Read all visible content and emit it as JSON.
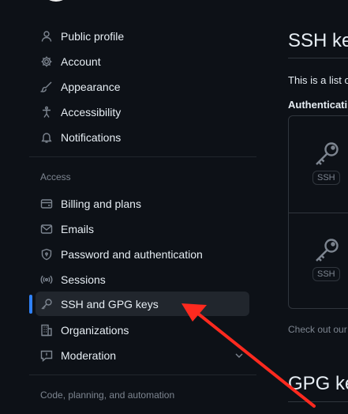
{
  "sidebar": {
    "items_top": [
      {
        "label": "Public profile",
        "icon": "person-icon"
      },
      {
        "label": "Account",
        "icon": "gear-icon"
      },
      {
        "label": "Appearance",
        "icon": "paintbrush-icon"
      },
      {
        "label": "Accessibility",
        "icon": "accessibility-icon"
      },
      {
        "label": "Notifications",
        "icon": "bell-icon"
      }
    ],
    "access_label": "Access",
    "items_access": [
      {
        "label": "Billing and plans",
        "icon": "credit-card-icon"
      },
      {
        "label": "Emails",
        "icon": "mail-icon"
      },
      {
        "label": "Password and authentication",
        "icon": "shield-lock-icon"
      },
      {
        "label": "Sessions",
        "icon": "broadcast-icon"
      },
      {
        "label": "SSH and GPG keys",
        "icon": "key-icon",
        "active": true
      },
      {
        "label": "Organizations",
        "icon": "organization-icon"
      },
      {
        "label": "Moderation",
        "icon": "report-icon"
      }
    ],
    "code_section_label": "Code, planning, and automation"
  },
  "main": {
    "ssh_title": "SSH ke",
    "intro": "This is a list o",
    "auth_heading": "Authenticati",
    "keys": [
      {
        "badge": "SSH"
      },
      {
        "badge": "SSH"
      }
    ],
    "checkout": "Check out our",
    "gpg_title": "GPG ke"
  },
  "colors": {
    "background": "#0d1117",
    "accent": "#2f81f7",
    "arrow": "#ff2a1f"
  }
}
